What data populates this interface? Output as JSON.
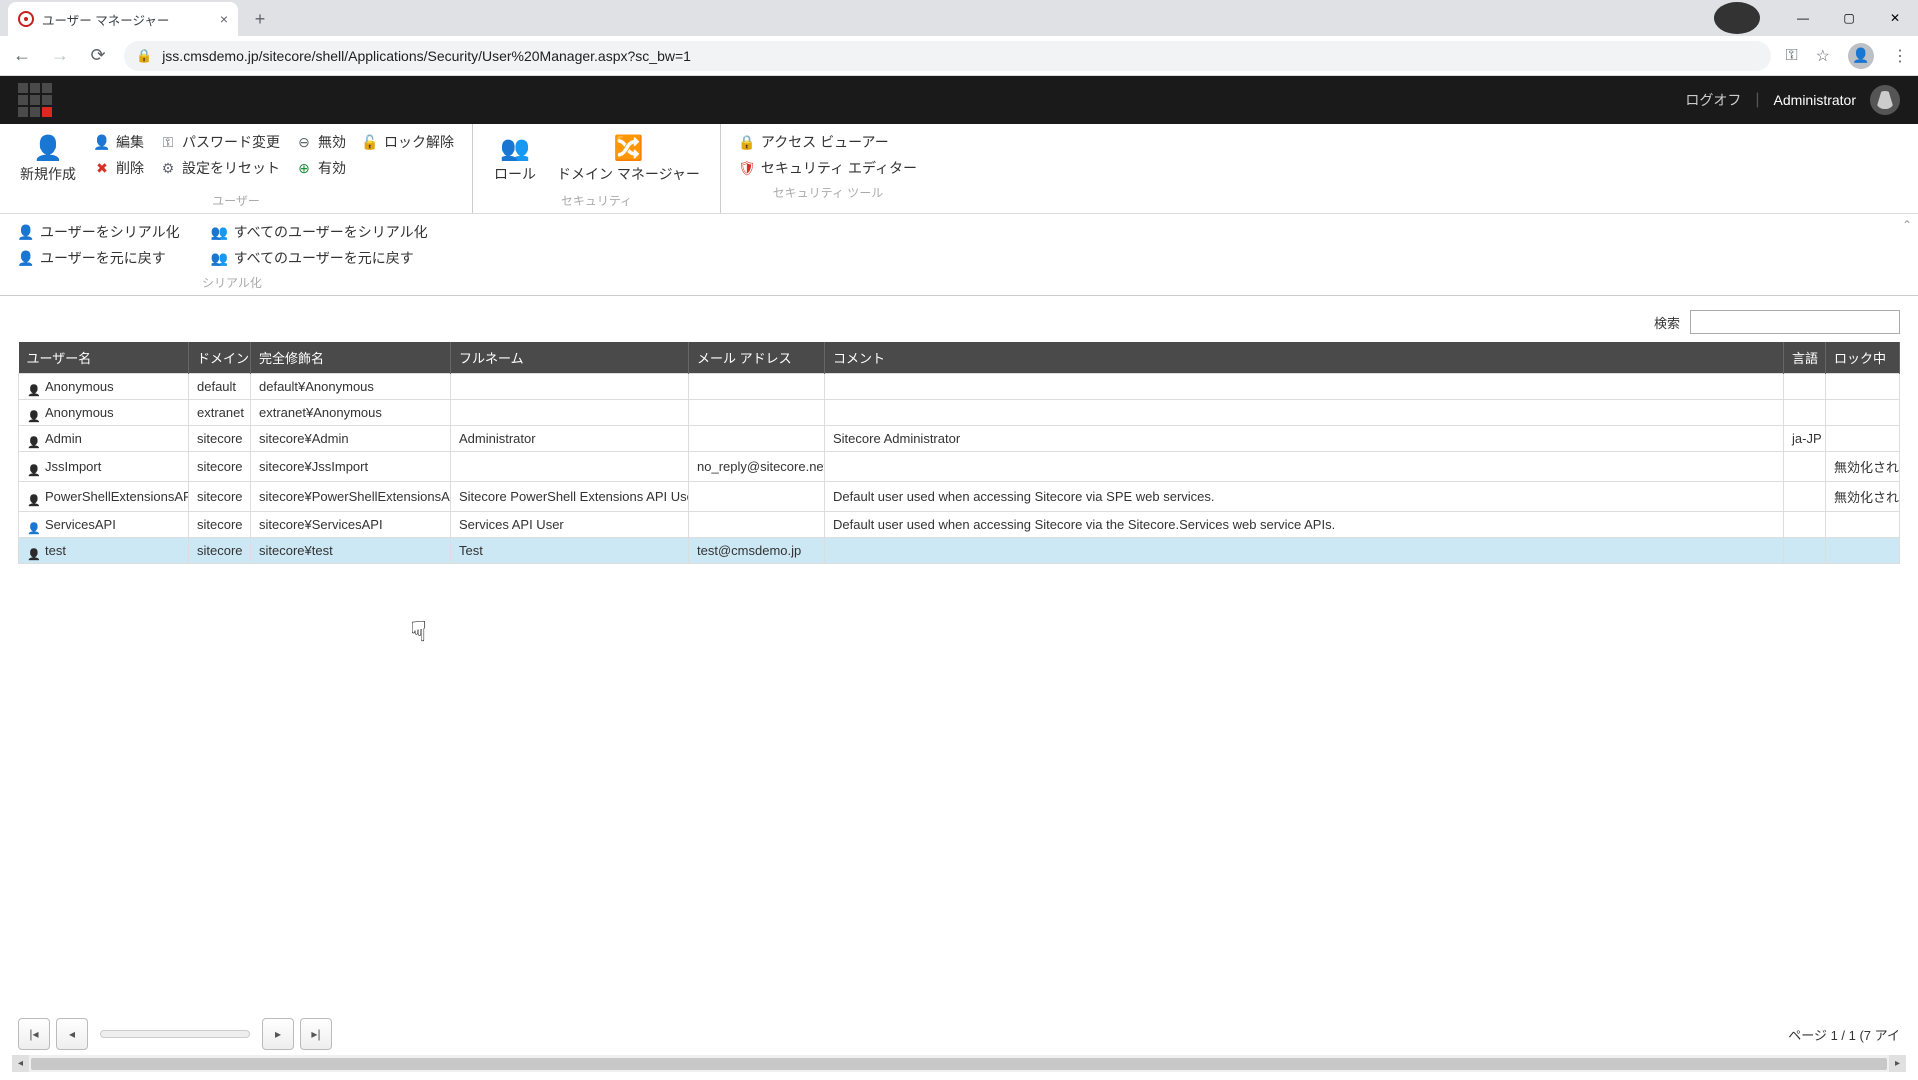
{
  "browser": {
    "tab_title": "ユーザー マネージャー",
    "url": "jss.cmsdemo.jp/sitecore/shell/Applications/Security/User%20Manager.aspx?sc_bw=1"
  },
  "header": {
    "logoff": "ログオフ",
    "user": "Administrator"
  },
  "ribbon": {
    "new": "新規作成",
    "edit": "編集",
    "delete": "削除",
    "change_password": "パスワード変更",
    "reset_settings": "設定をリセット",
    "disable": "無効",
    "enable": "有効",
    "unlock": "ロック解除",
    "group_users": "ユーザー",
    "role": "ロール",
    "domain_manager": "ドメイン マネージャー",
    "group_security": "セキュリティ",
    "access_viewer": "アクセス ビューアー",
    "security_editor": "セキュリティ エディター",
    "group_security_tools": "セキュリティ ツール",
    "serialize_user": "ユーザーをシリアル化",
    "revert_user": "ユーザーを元に戻す",
    "serialize_all": "すべてのユーザーをシリアル化",
    "revert_all": "すべてのユーザーを元に戻す",
    "group_serialize": "シリアル化"
  },
  "search": {
    "label": "検索"
  },
  "columns": {
    "username": "ユーザー名",
    "domain": "ドメイン",
    "fqn": "完全修飾名",
    "fullname": "フルネーム",
    "email": "メール アドレス",
    "comment": "コメント",
    "lang": "言語",
    "locked": "ロック中"
  },
  "rows": [
    {
      "icon": "dark",
      "username": "Anonymous",
      "domain": "default",
      "fqn": "default¥Anonymous",
      "fullname": "",
      "email": "",
      "comment": "",
      "lang": "",
      "locked": ""
    },
    {
      "icon": "dark",
      "username": "Anonymous",
      "domain": "extranet",
      "fqn": "extranet¥Anonymous",
      "fullname": "",
      "email": "",
      "comment": "",
      "lang": "",
      "locked": ""
    },
    {
      "icon": "dark",
      "username": "Admin",
      "domain": "sitecore",
      "fqn": "sitecore¥Admin",
      "fullname": "Administrator",
      "email": "",
      "comment": "Sitecore Administrator",
      "lang": "ja-JP",
      "locked": ""
    },
    {
      "icon": "dark",
      "username": "JssImport",
      "domain": "sitecore",
      "fqn": "sitecore¥JssImport",
      "fullname": "",
      "email": "no_reply@sitecore.net",
      "comment": "",
      "lang": "",
      "locked": "無効化されま"
    },
    {
      "icon": "dark",
      "username": "PowerShellExtensionsAPI",
      "domain": "sitecore",
      "fqn": "sitecore¥PowerShellExtensionsAPI",
      "fullname": "Sitecore PowerShell Extensions API User",
      "email": "",
      "comment": "Default user used when accessing Sitecore via SPE web services.",
      "lang": "",
      "locked": "無効化されま"
    },
    {
      "icon": "blue",
      "username": "ServicesAPI",
      "domain": "sitecore",
      "fqn": "sitecore¥ServicesAPI",
      "fullname": "Services API User",
      "email": "",
      "comment": "Default user used when accessing Sitecore via the Sitecore.Services web service APIs.",
      "lang": "",
      "locked": ""
    },
    {
      "icon": "dark",
      "username": "test",
      "domain": "sitecore",
      "fqn": "sitecore¥test",
      "fullname": "Test",
      "email": "test@cmsdemo.jp",
      "comment": "",
      "lang": "",
      "locked": "",
      "selected": true
    }
  ],
  "pager": {
    "info": "ページ 1 / 1 (7 アイ"
  }
}
